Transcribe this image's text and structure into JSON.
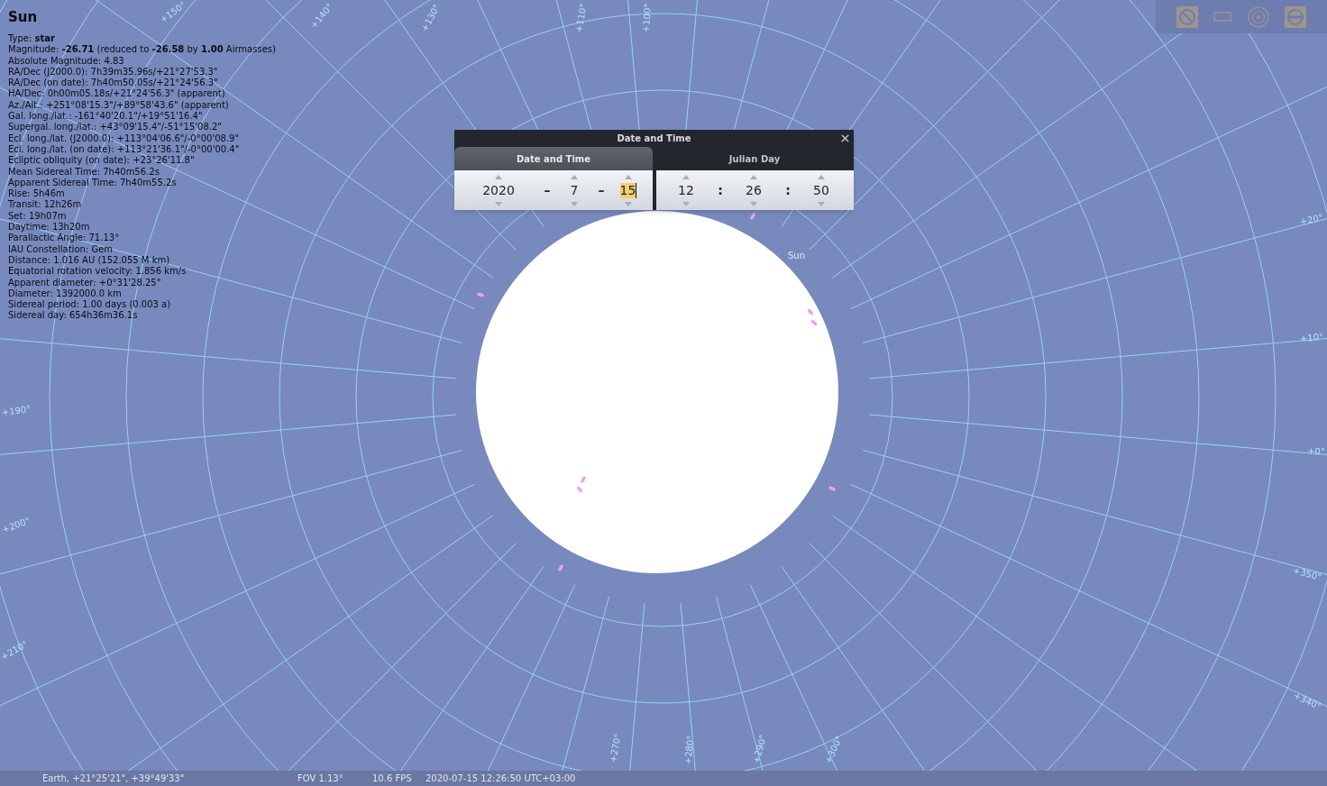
{
  "object_info": {
    "title": "Sun",
    "lines": [
      "Type: **star**",
      "Magnitude: **-26.71** (reduced to **-26.58** by **1.00** Airmasses)",
      "Absolute Magnitude: 4.83",
      "RA/Dec (J2000.0): 7h39m35.96s/+21°27'53.3\"",
      "RA/Dec (on date): 7h40m50.05s/+21°24'56.3\"",
      "HA/Dec: 0h00m05.18s/+21°24'56.3\" (apparent)",
      "Az./Alt.: +251°08'15.3\"/+89°58'43.6\" (apparent)",
      "Gal. long./lat.: -161°40'20.1\"/+19°51'16.4\"",
      "Supergal. long./lat.: +43°09'15.4\"/-51°15'08.2\"",
      "Ecl. long./lat. (J2000.0): +113°04'06.6\"/-0°00'08.9\"",
      "Ecl. long./lat. (on date): +113°21'36.1\"/-0°00'00.4\"",
      "Ecliptic obliquity (on date): +23°26'11.8\"",
      "Mean Sidereal Time: 7h40m56.2s",
      "Apparent Sidereal Time: 7h40m55.2s",
      "Rise: 5h46m",
      "Transit: 12h26m",
      "Set: 19h07m",
      "Daytime: 13h20m",
      "Parallactic Angle: 71.13°",
      "IAU Constellation: Gem",
      "Distance: 1.016 AU (152.055 M km)",
      "Equatorial rotation velocity: 1.856 km/s",
      "Apparent diameter: +0°31'28.25\"",
      "Diameter: 1392000.0 km",
      "Sidereal period: 1.00 days (0.003 a)",
      "Sidereal day: 654h36m36.1s"
    ]
  },
  "sky_map": {
    "object_label": "Sun",
    "grid_labels": [
      "+150°",
      "+140°",
      "+130°",
      "+110°",
      "+100°",
      "+190°",
      "+200°",
      "+210°",
      "+20°",
      "+10°",
      "+0°",
      "+350°",
      "+340°",
      "+270°",
      "+280°",
      "+290°",
      "+300°"
    ]
  },
  "date_time_dialog": {
    "title": "Date and Time",
    "tabs": [
      {
        "label": "Date and Time",
        "selected": true
      },
      {
        "label": "Julian Day",
        "selected": false
      }
    ],
    "panels": [
      {
        "items": [
          {
            "kind": "spinner",
            "value": "2020",
            "selected": false
          },
          {
            "kind": "separator",
            "text": "–"
          },
          {
            "kind": "spinner",
            "value": "7",
            "selected": false
          },
          {
            "kind": "separator",
            "text": "–"
          },
          {
            "kind": "spinner",
            "value": "15",
            "selected": true
          }
        ]
      },
      {
        "items": [
          {
            "kind": "spinner",
            "value": "12",
            "selected": false
          },
          {
            "kind": "separator",
            "text": ":"
          },
          {
            "kind": "spinner",
            "value": "26",
            "selected": false
          },
          {
            "kind": "separator",
            "text": ":"
          },
          {
            "kind": "spinner",
            "value": "50",
            "selected": false
          }
        ]
      }
    ]
  },
  "status_bar": {
    "location": "Earth, +21°25'21\", +39°49'33\"",
    "fov": "FOV 1.13°",
    "fps": "10.6 FPS",
    "datetime": "2020-07-15 12:26:50 UTC+03:00"
  }
}
